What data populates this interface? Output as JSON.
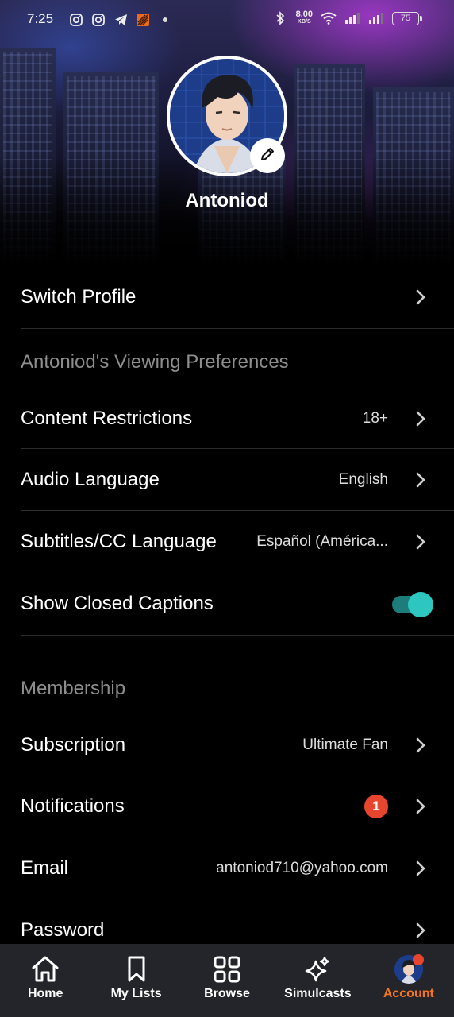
{
  "status_bar": {
    "time": "7:25",
    "speed_value": "8.00",
    "speed_unit": "KB/S",
    "battery": "75",
    "left_icons": [
      "instagram-icon",
      "instagram-icon",
      "telegram-icon",
      "app-icon",
      "dot-icon"
    ],
    "right_icons": [
      "bluetooth-icon",
      "wifi-icon",
      "signal-icon",
      "signal-icon"
    ]
  },
  "profile": {
    "name": "Antoniod",
    "edit_icon": "pencil-icon"
  },
  "switch_profile": {
    "label": "Switch Profile"
  },
  "viewing_preferences": {
    "heading": "Antoniod's Viewing Preferences",
    "content_restrictions": {
      "label": "Content Restrictions",
      "value": "18+"
    },
    "audio_language": {
      "label": "Audio Language",
      "value": "English"
    },
    "subtitles_language": {
      "label": "Subtitles/CC Language",
      "value": "Español (América..."
    },
    "closed_captions": {
      "label": "Show Closed Captions",
      "enabled": true
    }
  },
  "membership": {
    "heading": "Membership",
    "subscription": {
      "label": "Subscription",
      "value": "Ultimate Fan"
    },
    "notifications": {
      "label": "Notifications",
      "badge": "1"
    },
    "email": {
      "label": "Email",
      "value": "antoniod710@yahoo.com"
    },
    "password": {
      "label": "Password"
    }
  },
  "bottom_nav": {
    "items": [
      {
        "label": "Home",
        "icon": "home-icon",
        "active": false
      },
      {
        "label": "My Lists",
        "icon": "bookmark-icon",
        "active": false
      },
      {
        "label": "Browse",
        "icon": "grid-icon",
        "active": false
      },
      {
        "label": "Simulcasts",
        "icon": "sparkle-icon",
        "active": false
      },
      {
        "label": "Account",
        "icon": "avatar-icon",
        "active": true
      }
    ]
  },
  "colors": {
    "accent": "#f47521",
    "toggle_on": "#2ec7c0",
    "badge": "#e8452f",
    "nav_bg": "#23252b"
  }
}
